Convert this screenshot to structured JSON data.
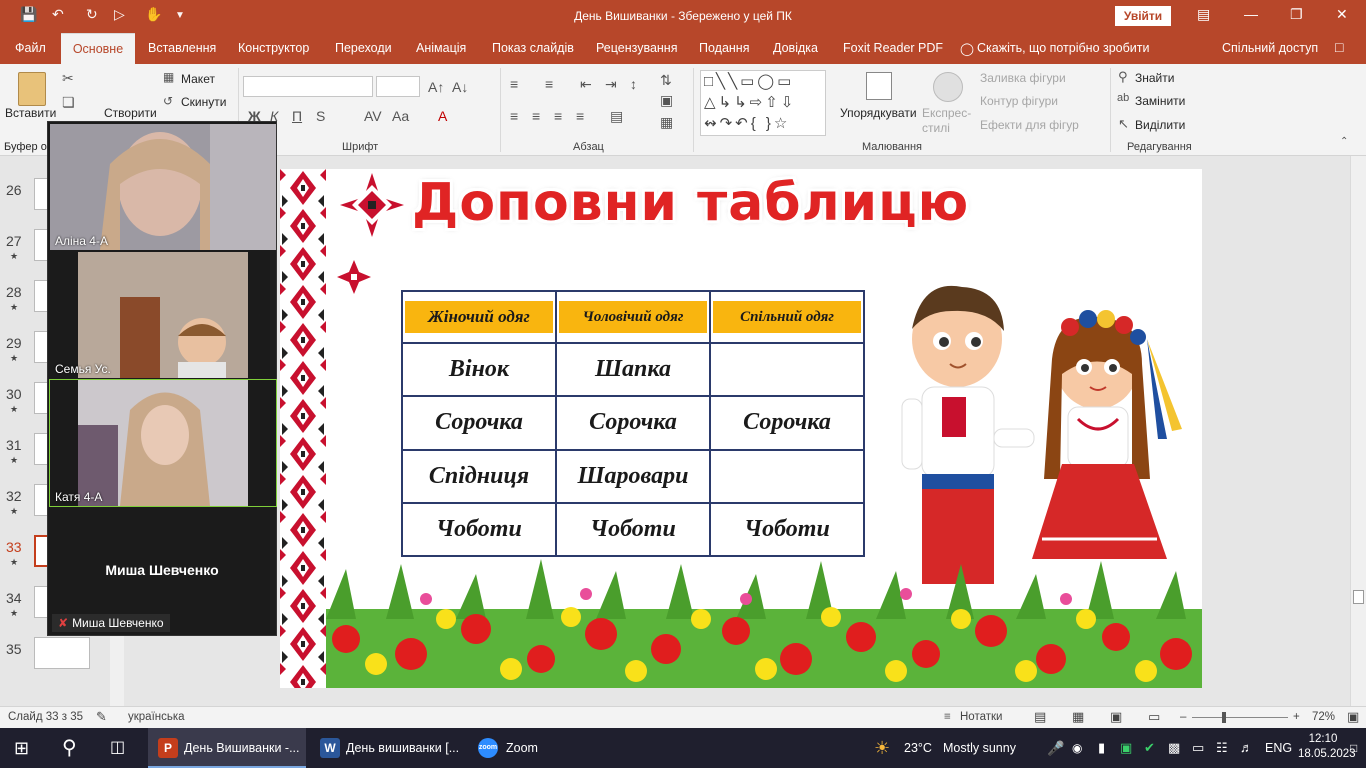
{
  "window": {
    "title": "День Вишиванки  -  Збережено у цей ПК",
    "signin": "Увійти"
  },
  "tabs": {
    "file": "Файл",
    "home": "Основне",
    "insert": "Вставлення",
    "design": "Конструктор",
    "transitions": "Переходи",
    "animations": "Анімація",
    "slideshow": "Показ слайдів",
    "review": "Рецензування",
    "view": "Подання",
    "help": "Довідка",
    "foxit": "Foxit Reader PDF",
    "tellme": "Скажіть, що потрібно зробити",
    "share": "Спільний доступ"
  },
  "ribbon": {
    "paste": "Вставити",
    "clipboard": "Буфер о",
    "new_slide": "Створити",
    "layout": "Макет",
    "reset": "Скинути",
    "font_group": "Шрифт",
    "paragraph_group": "Абзац",
    "drawing_group": "Малювання",
    "arrange": "Упорядкувати",
    "quick_styles": "Експрес-стилі",
    "shape_fill": "Заливка фігури",
    "shape_outline": "Контур фігури",
    "shape_effects": "Ефекти для фігур",
    "find": "Знайти",
    "replace": "Замінити",
    "select": "Виділити",
    "editing_group": "Редагування"
  },
  "thumbnails": [
    {
      "num": "26",
      "star": false
    },
    {
      "num": "27",
      "star": true
    },
    {
      "num": "28",
      "star": true
    },
    {
      "num": "29",
      "star": true
    },
    {
      "num": "30",
      "star": true
    },
    {
      "num": "31",
      "star": true
    },
    {
      "num": "32",
      "star": true
    },
    {
      "num": "33",
      "star": true
    },
    {
      "num": "34",
      "star": true
    },
    {
      "num": "35",
      "star": false
    }
  ],
  "video": {
    "p1": "Аліна 4-А",
    "p2": "Семья Ус.",
    "p3": "Катя  4-А",
    "p4_big": "Миша Шевченко",
    "p4": "Миша Шевченко"
  },
  "slide": {
    "title": "Доповни таблицю",
    "headers": [
      "Жіночий одяг",
      "Чоловічий одяг",
      "Спільний одяг"
    ],
    "rows": [
      [
        "Вінок",
        "Шапка",
        ""
      ],
      [
        "Сорочка",
        "Сорочка",
        "Сорочка"
      ],
      [
        "Спідниця",
        "Шаровари",
        ""
      ],
      [
        "Чоботи",
        "Чоботи",
        "Чоботи"
      ]
    ]
  },
  "status": {
    "slide_pos": "Слайд 33 з 35",
    "language": "українська",
    "notes": "Нотатки",
    "zoom": "72%"
  },
  "taskbar": {
    "ppt": "День Вишиванки -...",
    "word": "День вишиванки [...",
    "zoom": "Zoom",
    "weather_temp": "23°C",
    "weather_text": "Mostly sunny",
    "lang": "ENG",
    "time": "12:10",
    "date": "18.05.2023"
  },
  "colors": {
    "accent": "#b7472a",
    "header_fill": "#f9b50f",
    "title_red": "#e02424",
    "table_border": "#2b3a6b"
  }
}
